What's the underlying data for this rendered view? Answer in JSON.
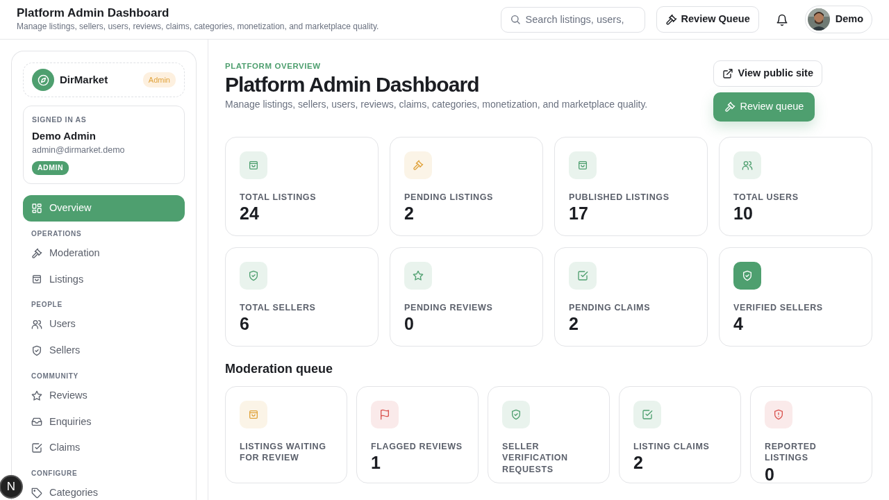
{
  "header": {
    "title": "Platform Admin Dashboard",
    "subtitle": "Manage listings, sellers, users, reviews, claims, categories, monetization, and marketplace quality.",
    "search": {
      "placeholder": "Search listings, users,"
    },
    "review_button": "Review Queue",
    "user": "Demo"
  },
  "sidebar": {
    "brand": "DirMarket",
    "brand_badge": "Admin",
    "account": {
      "caption": "SIGNED IN AS",
      "name": "Demo Admin",
      "email": "admin@dirmarket.demo",
      "role": "ADMIN"
    },
    "groups": [
      {
        "items": [
          {
            "label": "Overview",
            "kind": "grid",
            "selected": true
          }
        ]
      },
      {
        "heading": "OPERATIONS",
        "items": [
          {
            "label": "Moderation",
            "kind": "gavel",
            "selected": false
          },
          {
            "label": "Listings",
            "kind": "bag",
            "selected": false
          }
        ]
      },
      {
        "heading": "PEOPLE",
        "items": [
          {
            "label": "Users",
            "kind": "users",
            "selected": false
          },
          {
            "label": "Sellers",
            "kind": "shield",
            "selected": false
          }
        ]
      },
      {
        "heading": "COMMUNITY",
        "items": [
          {
            "label": "Reviews",
            "kind": "star",
            "selected": false
          },
          {
            "label": "Enquiries",
            "kind": "inbox",
            "selected": false
          },
          {
            "label": "Claims",
            "kind": "check",
            "selected": false
          }
        ]
      },
      {
        "heading": "CONFIGURE",
        "items": [
          {
            "label": "Categories",
            "kind": "tag",
            "selected": false
          }
        ]
      }
    ]
  },
  "page": {
    "eyebrow": "PLATFORM OVERVIEW",
    "title": "Platform Admin Dashboard",
    "description": "Manage listings, sellers, users, reviews, claims, categories, monetization, and marketplace quality.",
    "public_button": "View public site",
    "queue_button": "Review queue"
  },
  "stats": [
    {
      "label": "TOTAL LISTINGS",
      "value": "24",
      "kind": "bag",
      "color": "#4e9f6f",
      "highlighted": false
    },
    {
      "label": "PENDING LISTINGS",
      "value": "2",
      "kind": "gavel",
      "color": "#e0a33c",
      "highlighted": false
    },
    {
      "label": "PUBLISHED LISTINGS",
      "value": "17",
      "kind": "bag",
      "color": "#4e9f6f",
      "highlighted": false
    },
    {
      "label": "TOTAL USERS",
      "value": "10",
      "kind": "users",
      "color": "#4e9f6f",
      "highlighted": false
    },
    {
      "label": "TOTAL SELLERS",
      "value": "6",
      "kind": "shield",
      "color": "#4e9f6f",
      "highlighted": false
    },
    {
      "label": "PENDING REVIEWS",
      "value": "0",
      "kind": "star",
      "color": "#4e9f6f",
      "highlighted": false
    },
    {
      "label": "PENDING CLAIMS",
      "value": "2",
      "kind": "check",
      "color": "#4e9f6f",
      "highlighted": false
    },
    {
      "label": "VERIFIED SELLERS",
      "value": "4",
      "kind": "shield",
      "color": "#4e9f6f",
      "highlighted": true
    }
  ],
  "moderation": {
    "title": "Moderation queue",
    "cards": [
      {
        "label": "LISTINGS WAITING FOR REVIEW",
        "kind": "bag",
        "color": "#e0a33c"
      },
      {
        "label": "FLAGGED REVIEWS",
        "value": "1",
        "kind": "flag",
        "color": "#d9534f"
      },
      {
        "label": "SELLER VERIFICATION REQUESTS",
        "kind": "shield",
        "color": "#4e9f6f"
      },
      {
        "label": "LISTING CLAIMS",
        "value": "2",
        "kind": "check",
        "color": "#4e9f6f"
      },
      {
        "label": "REPORTED LISTINGS",
        "value": "0",
        "kind": "alert",
        "color": "#d9534f"
      }
    ]
  },
  "dev_badge": "N"
}
